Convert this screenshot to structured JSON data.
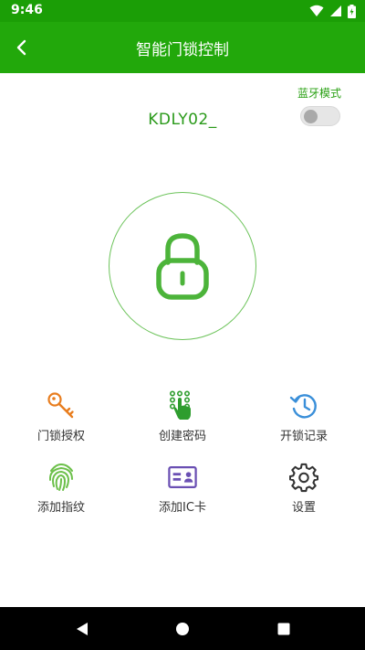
{
  "status_bar": {
    "time": "9:46",
    "icons": [
      "wifi-icon",
      "signal-icon",
      "battery-icon"
    ]
  },
  "app_bar": {
    "title": "智能门锁控制",
    "back_icon": "chevron-left-icon"
  },
  "bluetooth": {
    "label": "蓝牙模式",
    "enabled": false
  },
  "device": {
    "name": "KDLY02_"
  },
  "lock_button": {
    "icon": "padlock-icon"
  },
  "menu": {
    "items": [
      {
        "label": "门锁授权",
        "icon": "key-icon",
        "color": "#e87d1e"
      },
      {
        "label": "创建密码",
        "icon": "keypad-hand-icon",
        "color": "#2e9d2e"
      },
      {
        "label": "开锁记录",
        "icon": "history-icon",
        "color": "#3a8fd9"
      },
      {
        "label": "添加指纹",
        "icon": "fingerprint-icon",
        "color": "#6cc04a"
      },
      {
        "label": "添加IC卡",
        "icon": "id-card-icon",
        "color": "#6a4fb3"
      },
      {
        "label": "设置",
        "icon": "gear-icon",
        "color": "#333333"
      }
    ]
  },
  "colors": {
    "primary": "#22a80b",
    "status_bar": "#1b9e06",
    "accent_text": "#2a9a1a"
  },
  "nav_bar": {
    "buttons": [
      "back-triangle-icon",
      "home-circle-icon",
      "recents-square-icon"
    ]
  }
}
